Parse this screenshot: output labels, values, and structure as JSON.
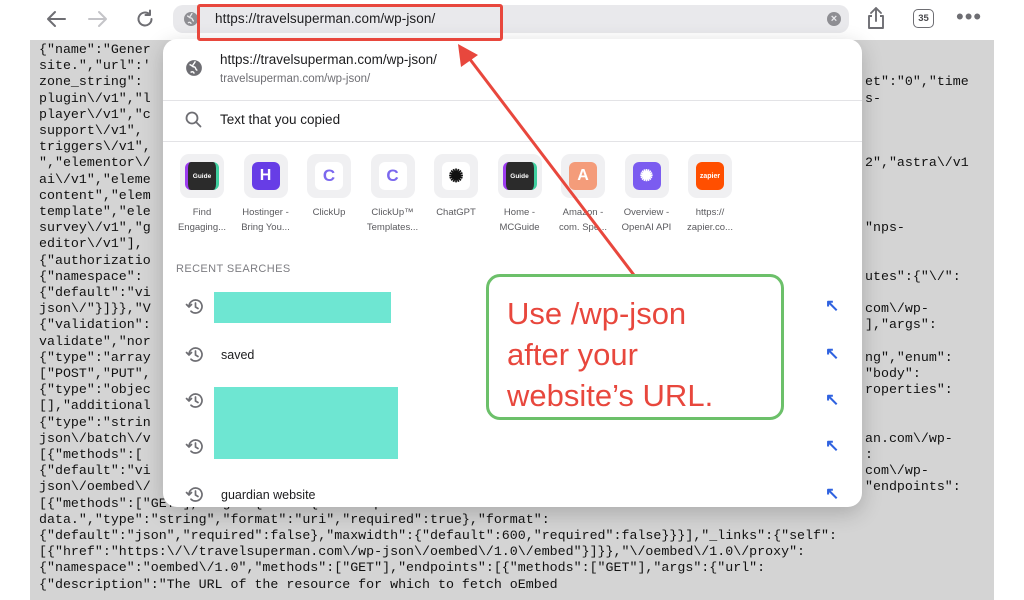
{
  "toolbar": {
    "url": "https://travelsuperman.com/wp-json/",
    "tab_count": "35"
  },
  "json_lines": [
    "{\"name\":\"Gener",
    "site.\",\"url\":'",
    "zone_string\":",
    "plugin\\/v1\",\"l",
    "player\\/v1\",\"c",
    "support\\/v1\",",
    "triggers\\/v1\",",
    "\",\"elementor\\/",
    "ai\\/v1\",\"eleme",
    "content\",\"elem",
    "template\",\"ele",
    "survey\\/v1\",\"g",
    "editor\\/v1\"],",
    "{\"authorizatio",
    "{\"namespace\":",
    "{\"default\":\"vi",
    "json\\/\"}]}},\"V",
    "{\"validation\":",
    "validate\",\"nor",
    "{\"type\":\"array",
    "[\"POST\",\"PUT\",",
    "{\"type\":\"objec",
    "[],\"additional",
    "{\"type\":\"strin",
    "json\\/batch\\/v",
    "[{\"methods\":[",
    "{\"default\":\"vi",
    "json\\/oembed\\/",
    "[{\"methods\":[\"GET\"],\"args\":{\"url\":{\"description\":\"The URL of the resource for which to fetch oEmbed",
    "data.\",\"type\":\"string\",\"format\":\"uri\",\"required\":true},\"format\":",
    "{\"default\":\"json\",\"required\":false},\"maxwidth\":{\"default\":600,\"required\":false}}}],\"_links\":{\"self\":",
    "[{\"href\":\"https:\\/\\/travelsuperman.com\\/wp-json\\/oembed\\/1.0\\/embed\"}]}},\"\\/oembed\\/1.0\\/proxy\":",
    "{\"namespace\":\"oembed\\/1.0\",\"methods\":[\"GET\"],\"endpoints\":[{\"methods\":[\"GET\"],\"args\":{\"url\":",
    "{\"description\":\"The URL of the resource for which to fetch oEmbed"
  ],
  "json_right": [
    "et\":\"0\",\"time",
    "s-",
    "2\",\"astra\\/v1",
    "\"nps-",
    "utes\":{\"\\/\":",
    "com\\/wp-",
    "],\"args\":",
    "ng\",\"enum\":",
    "\"body\":",
    "roperties\":",
    "an.com\\/wp-",
    ":",
    "com\\/wp-",
    "\"endpoints\":"
  ],
  "dropdown": {
    "top_hit": {
      "title": "https://travelsuperman.com/wp-json/",
      "subtitle": "travelsuperman.com/wp-json/"
    },
    "clipboard_label": "Text that you copied",
    "favorites": [
      {
        "line1": "Find",
        "line2": "Engaging...",
        "icon": "guide-icon",
        "color": "#2b2b2b",
        "glyph": "Guide"
      },
      {
        "line1": "Hostinger -",
        "line2": "Bring You...",
        "icon": "hostinger-icon",
        "color": "#673de6",
        "glyph": "H"
      },
      {
        "line1": "ClickUp",
        "line2": "",
        "icon": "clickup-icon",
        "color": "#ffffff",
        "glyph": "C"
      },
      {
        "line1": "ClickUp™",
        "line2": "Templates...",
        "icon": "clickup-icon",
        "color": "#ffffff",
        "glyph": "C"
      },
      {
        "line1": "ChatGPT",
        "line2": "",
        "icon": "chatgpt-icon",
        "color": "#ffffff",
        "glyph": "✺"
      },
      {
        "line1": "Home -",
        "line2": "MCGuide",
        "icon": "guide-icon",
        "color": "#2b2b2b",
        "glyph": "Guide"
      },
      {
        "line1": "Amazon -",
        "line2": "com. Spe...",
        "icon": "letter-a-icon",
        "color": "#f49c7a",
        "glyph": "A"
      },
      {
        "line1": "Overview -",
        "line2": "OpenAI API",
        "icon": "openai-icon",
        "color": "#7b5cf0",
        "glyph": "✺"
      },
      {
        "line1": "https://",
        "line2": "zapier.co...",
        "icon": "zapier-icon",
        "color": "#ff4f00",
        "glyph": "zapier"
      }
    ],
    "recent_header": "RECENT SEARCHES",
    "recent": [
      "",
      "saved",
      "",
      "",
      "guardian website"
    ]
  },
  "callout": {
    "text": "Use /wp-json\nafter your\nwebsite’s URL."
  },
  "colors": {
    "annotation_red": "#e8473d",
    "callout_green": "#6cc06a",
    "redaction": "#6ee6d2",
    "link_blue": "#2f62e0"
  }
}
